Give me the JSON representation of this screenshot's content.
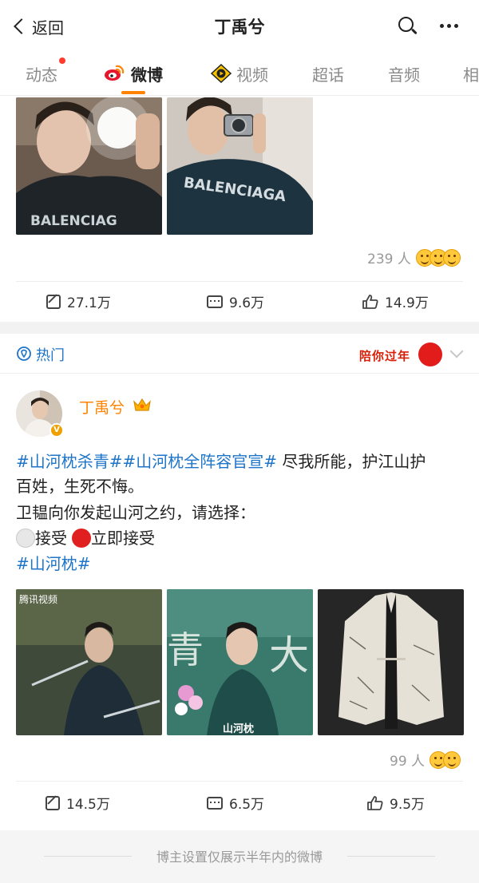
{
  "header": {
    "back_label": "返回",
    "title": "丁禹兮"
  },
  "tabs": [
    {
      "label": "动态"
    },
    {
      "label": "微博"
    },
    {
      "label": "视频"
    },
    {
      "label": "超话"
    },
    {
      "label": "音频"
    },
    {
      "label": "相"
    }
  ],
  "post1": {
    "reactions_count": "239 人",
    "reposts": "27.1万",
    "comments": "9.6万",
    "likes": "14.9万"
  },
  "hot_section": {
    "label": "热门",
    "badge_text": "陪你过年"
  },
  "post2": {
    "author": "丁禹兮",
    "verified_mark": "V",
    "line1_tags": "#山河枕杀青##山河枕全阵容官宣#",
    "line1_text": " 尽我所能，护江山护",
    "line2": "百姓，生死不悔。",
    "line3": "卫韫向你发起山河之约，请选择：",
    "option_accept": "接受",
    "option_accept_now": "立即接受",
    "tag_line": "#山河枕#",
    "image1_watermark": "腾讯视频",
    "image2_poster_text": "山河枕",
    "reactions_count": "99 人",
    "reposts": "14.5万",
    "comments": "6.5万",
    "likes": "9.5万"
  },
  "footer": {
    "note": "博主设置仅展示半年内的微博"
  },
  "colors": {
    "accent": "#ff8200",
    "link": "#1d74c8",
    "badge_red": "#d81e06"
  }
}
